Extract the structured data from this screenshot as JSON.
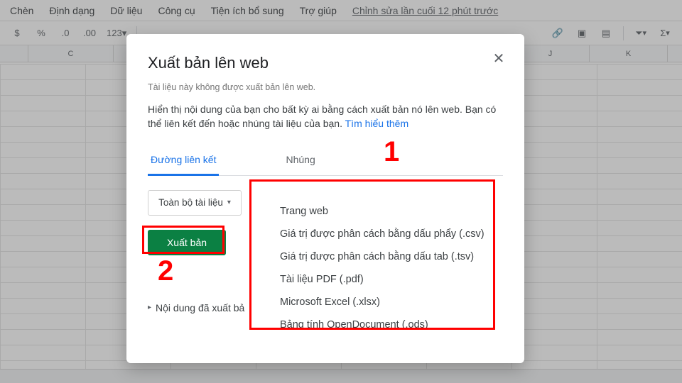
{
  "menubar": {
    "items": [
      "Chèn",
      "Định dạng",
      "Dữ liệu",
      "Công cụ",
      "Tiện ích bổ sung",
      "Trợ giúp"
    ],
    "last_edit": "Chỉnh sửa lần cuối 12 phút trước"
  },
  "toolbar": {
    "currency": "$",
    "percent": "%",
    "dec_dec": ".0",
    "inc_dec": ".00",
    "more_formats": "123"
  },
  "columns": [
    "C",
    "J",
    "K"
  ],
  "dialog": {
    "title": "Xuất bản lên web",
    "subtitle": "Tài liệu này không được xuất bản lên web.",
    "description": "Hiển thị nội dung của bạn cho bất kỳ ai bằng cách xuất bản nó lên web. Bạn có thể liên kết đến hoặc nhúng tài liệu của bạn. ",
    "learn_more": "Tìm hiểu thêm",
    "tabs": {
      "link": "Đường liên kết",
      "embed": "Nhúng"
    },
    "scope_label": "Toàn bộ tài liệu",
    "publish_label": "Xuất bản",
    "formats": [
      "Trang web",
      "Giá trị được phân cách bằng dấu phẩy (.csv)",
      "Giá trị được phân cách bằng dấu tab (.tsv)",
      "Tài liệu PDF (.pdf)",
      "Microsoft Excel (.xlsx)",
      "Bảng tính OpenDocument (.ods)"
    ],
    "published_section": "Nội dung đã xuất bả"
  },
  "annotations": {
    "n1": "1",
    "n2": "2"
  }
}
